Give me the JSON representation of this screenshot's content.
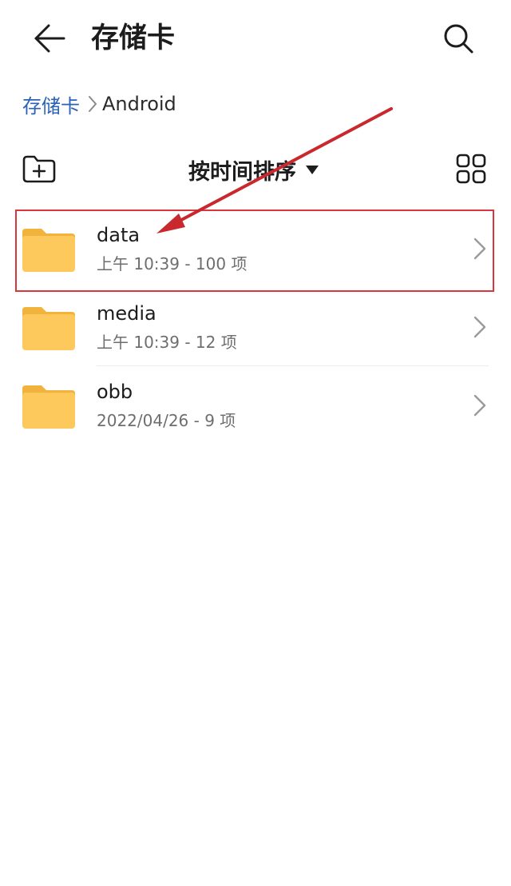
{
  "header": {
    "title": "存储卡",
    "back_icon": "arrow-left-icon",
    "search_icon": "search-icon"
  },
  "breadcrumb": {
    "root": "存储卡",
    "current": "Android"
  },
  "toolbar": {
    "new_folder_icon": "new-folder-icon",
    "sort_label": "按时间排序",
    "grid_icon": "grid-view-icon"
  },
  "files": [
    {
      "name": "data",
      "meta": "上午 10:39  - 100 项",
      "highlighted": true
    },
    {
      "name": "media",
      "meta": "上午 10:39  - 12 项",
      "highlighted": false
    },
    {
      "name": "obb",
      "meta": "2022/04/26 - 9 项",
      "highlighted": false
    }
  ],
  "colors": {
    "folder": "#fdc95c",
    "folder_tab": "#f1b33b",
    "breadcrumb_link": "#2a63b8",
    "annotation": "#c9282e"
  }
}
